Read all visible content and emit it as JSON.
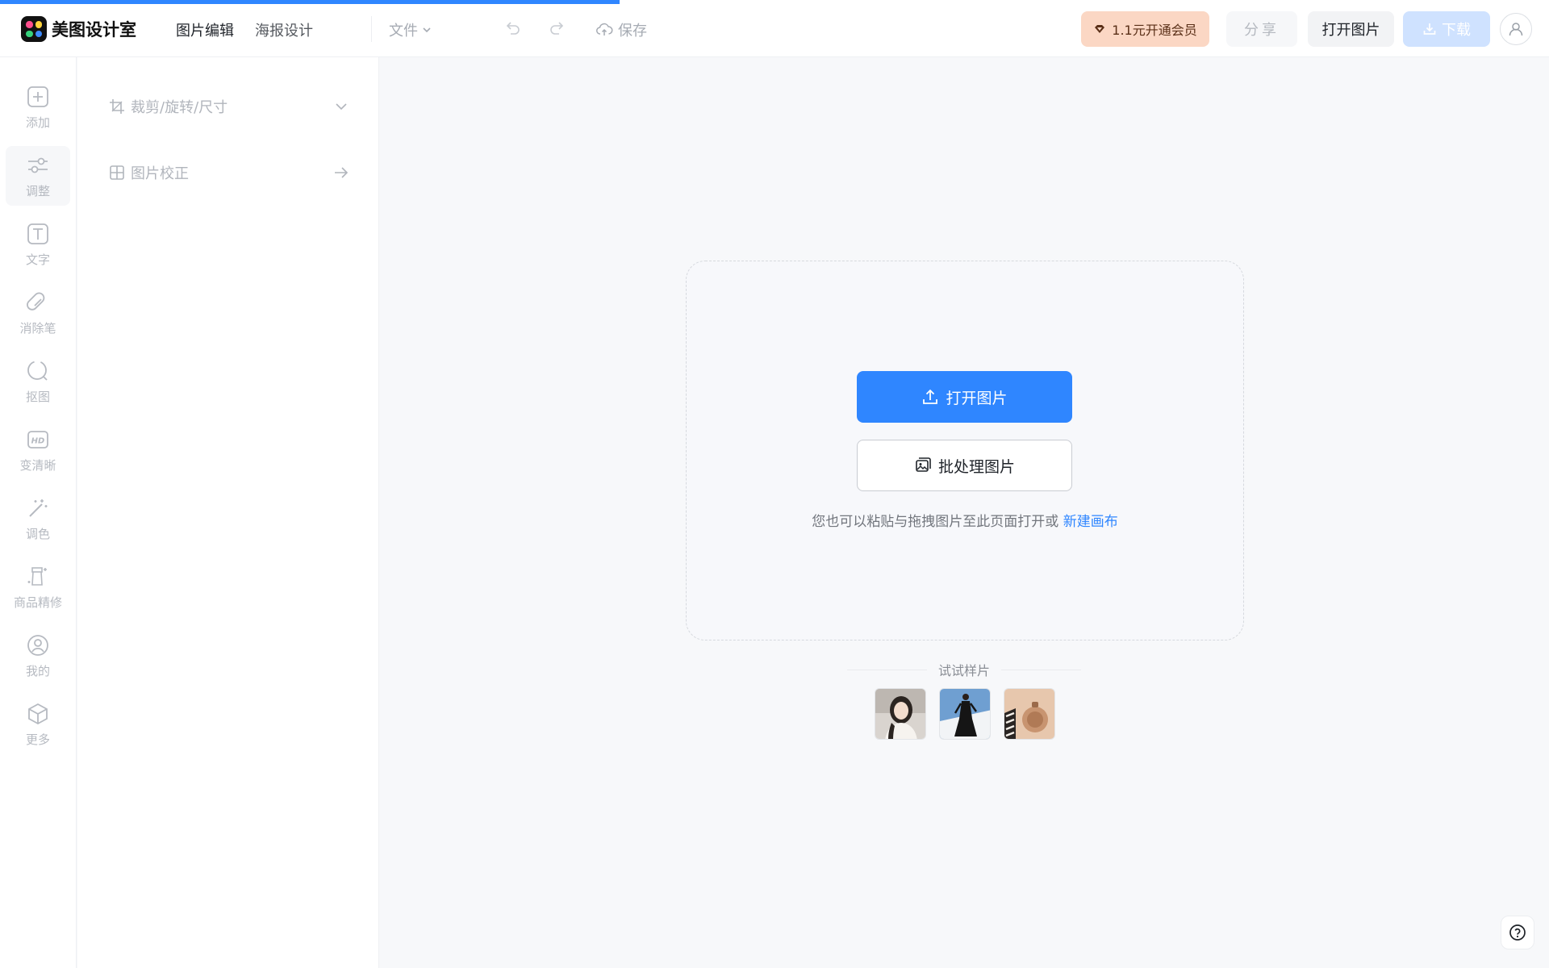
{
  "app": {
    "name": "美图设计室",
    "brand_color": "#2f86ff"
  },
  "header": {
    "nav": [
      {
        "label": "图片编辑",
        "active": true
      },
      {
        "label": "海报设计",
        "active": false
      }
    ],
    "file_menu": "文件",
    "save_label": "保存",
    "vip_label": "1.1元开通会员",
    "share_label": "分享",
    "open_label": "打开图片",
    "download_label": "下载"
  },
  "tools": [
    {
      "label": "添加",
      "icon": "plus-square-icon"
    },
    {
      "label": "调整",
      "icon": "sliders-icon",
      "active": true
    },
    {
      "label": "文字",
      "icon": "text-icon"
    },
    {
      "label": "消除笔",
      "icon": "eraser-icon"
    },
    {
      "label": "抠图",
      "icon": "cutout-icon"
    },
    {
      "label": "变清晰",
      "icon": "hd-icon"
    },
    {
      "label": "调色",
      "icon": "magic-wand-icon"
    },
    {
      "label": "商品精修",
      "icon": "product-retouch-icon"
    },
    {
      "label": "我的",
      "icon": "user-circle-icon"
    },
    {
      "label": "更多",
      "icon": "cube-icon"
    }
  ],
  "panel": {
    "items": [
      {
        "label": "裁剪/旋转/尺寸",
        "icon": "crop-icon",
        "trail": "chevron-down-icon"
      },
      {
        "label": "图片校正",
        "icon": "grid-icon",
        "trail": "arrow-right-icon"
      }
    ]
  },
  "canvas": {
    "open_button": "打开图片",
    "batch_button": "批处理图片",
    "hint_text": "您也可以粘贴与拖拽图片至此页面打开或 ",
    "new_canvas_link": "新建画布",
    "samples_title": "试试样片"
  }
}
